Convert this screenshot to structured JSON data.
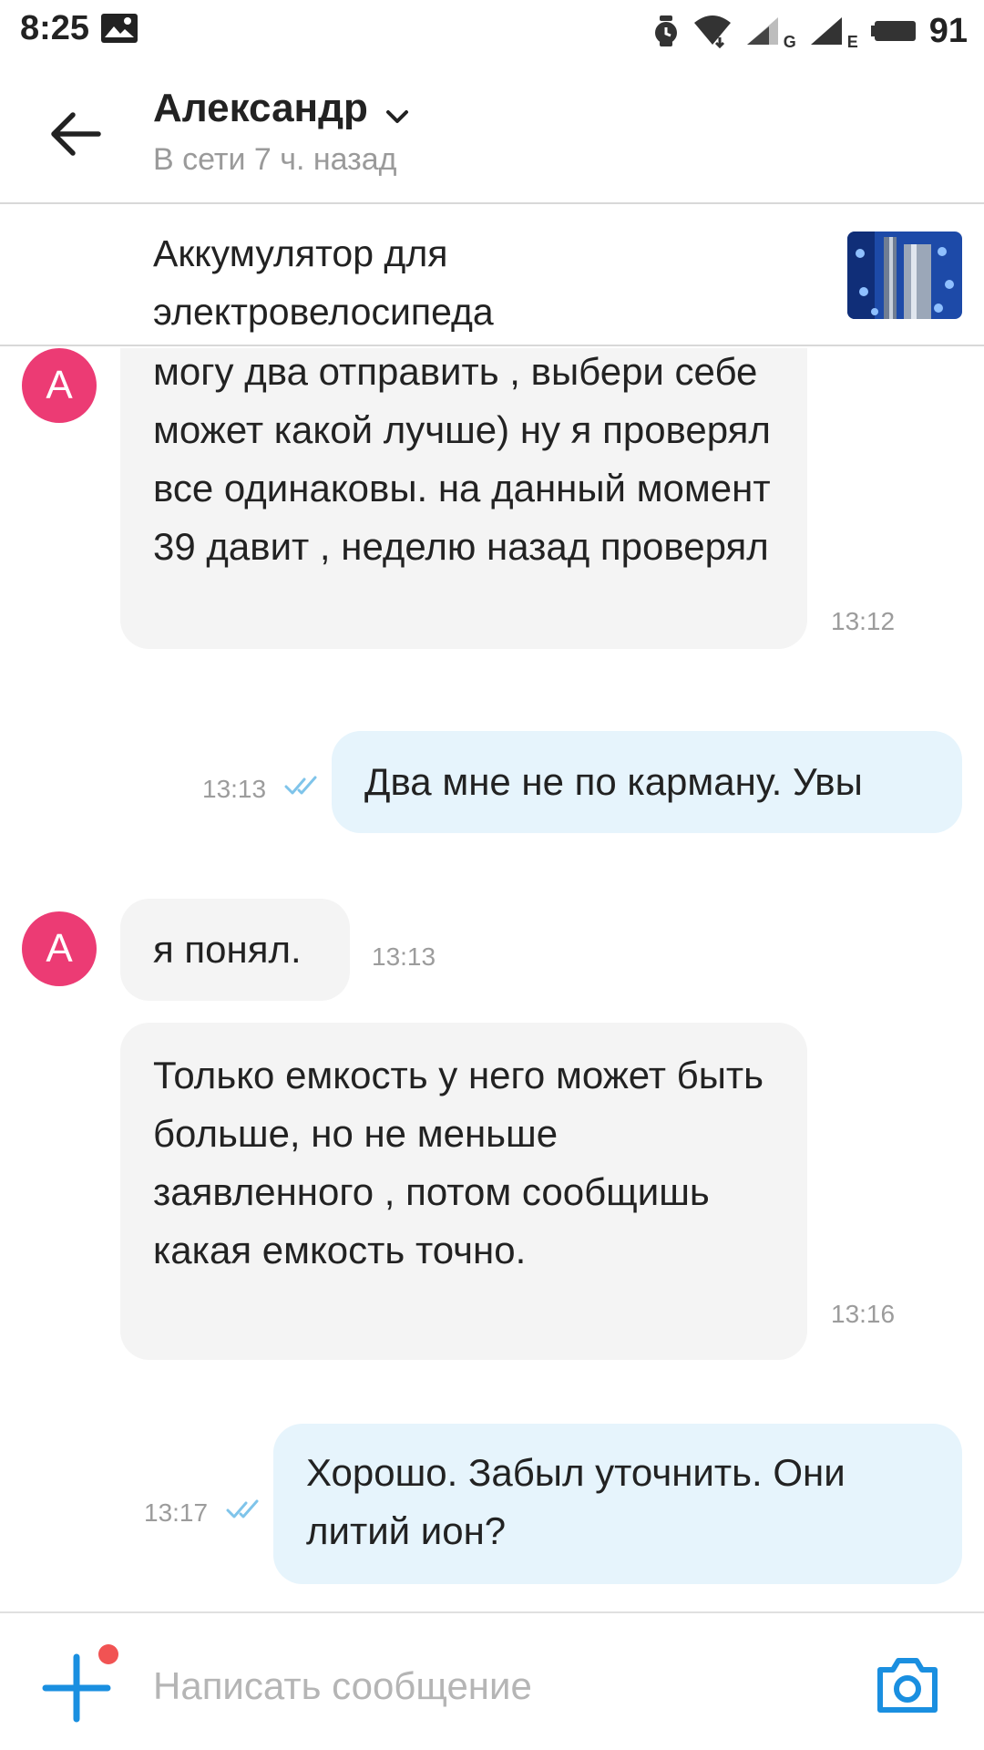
{
  "status_bar": {
    "time": "8:25",
    "battery_level": "91",
    "net1_label": "G",
    "net2_label": "E"
  },
  "header": {
    "contact_name": "Александр",
    "contact_status": "В сети 7 ч. назад"
  },
  "listing": {
    "title": "Аккумулятор для электровелосипеда"
  },
  "messages": [
    {
      "direction": "in",
      "avatar_letter": "А",
      "text": "могу два отправить , выбери себе может какой лучше) ну я проверял все одинаковы. на данный момент 39 давит , неделю назад проверял",
      "time": "13:12"
    },
    {
      "direction": "out",
      "text": "Два мне не по карману. Увы",
      "time": "13:13",
      "read": true
    },
    {
      "direction": "in",
      "avatar_letter": "А",
      "text": "я понял.",
      "time": "13:13"
    },
    {
      "direction": "in",
      "text": "Только емкость у него может быть больше, но не меньше заявленного , потом сообщишь какая емкость точно.",
      "time": "13:16"
    },
    {
      "direction": "out",
      "text": "Хорошо. Забыл уточнить. Они литий ион?",
      "time": "13:17",
      "read": true
    }
  ],
  "composer": {
    "placeholder": "Написать сообщение"
  },
  "icons": {
    "back": "arrow-left-icon",
    "chevron": "chevron-down-icon",
    "add": "plus-icon",
    "camera": "camera-icon",
    "read_receipt": "double-check-icon"
  },
  "colors": {
    "accent": "#1a8fe0",
    "avatar": "#ec3b74",
    "incoming_bubble": "#f4f4f4",
    "outgoing_bubble": "#e6f4fc",
    "notification_dot": "#f15353",
    "read_check": "#7fc4ea"
  }
}
